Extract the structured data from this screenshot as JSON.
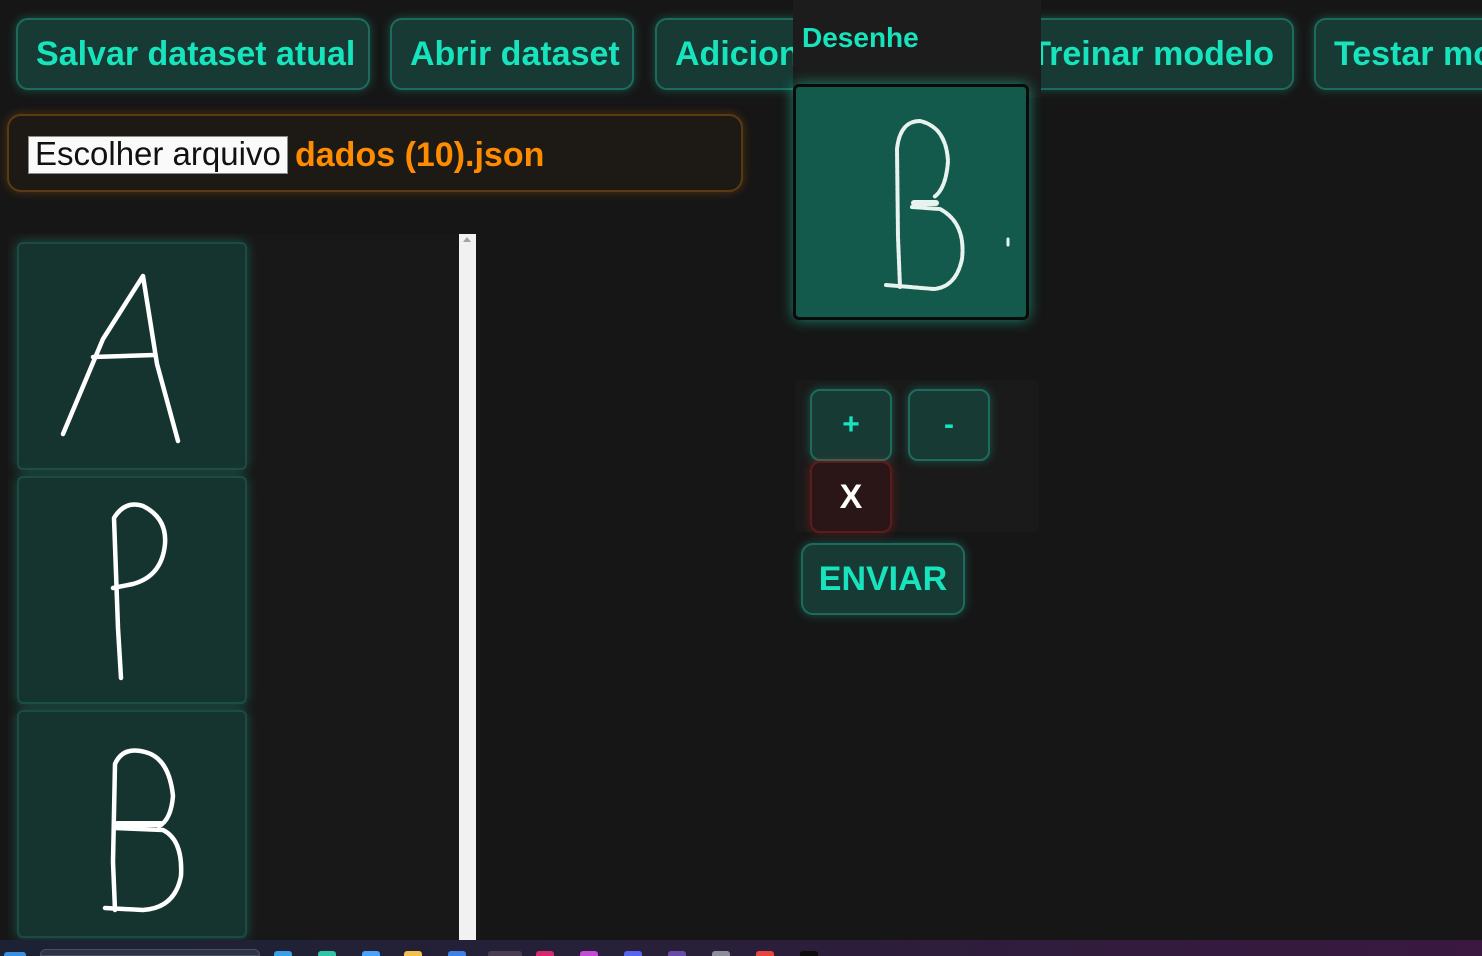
{
  "toolbar": {
    "save_label": "Salvar dataset atual",
    "open_label": "Abrir dataset",
    "add_label": "Adicionar desenho",
    "train_label": "Treinar modelo",
    "test_label": "Testar modelo"
  },
  "file_input": {
    "button_label": "Escolher arquivo",
    "file_name": "dados (10).json"
  },
  "samples": [
    "A",
    "P",
    "B"
  ],
  "draw_panel": {
    "title": "Desenhe",
    "current_letter": "B"
  },
  "controls": {
    "plus_label": "+",
    "minus_label": "-",
    "clear_label": "X",
    "send_label": "ENVIAR"
  },
  "colors": {
    "accent": "#17e3bd",
    "file_name": "#ff8c00",
    "panel": "#15342f",
    "canvas": "#135a4c",
    "background": "#161616",
    "danger": "#5a1c1c"
  }
}
